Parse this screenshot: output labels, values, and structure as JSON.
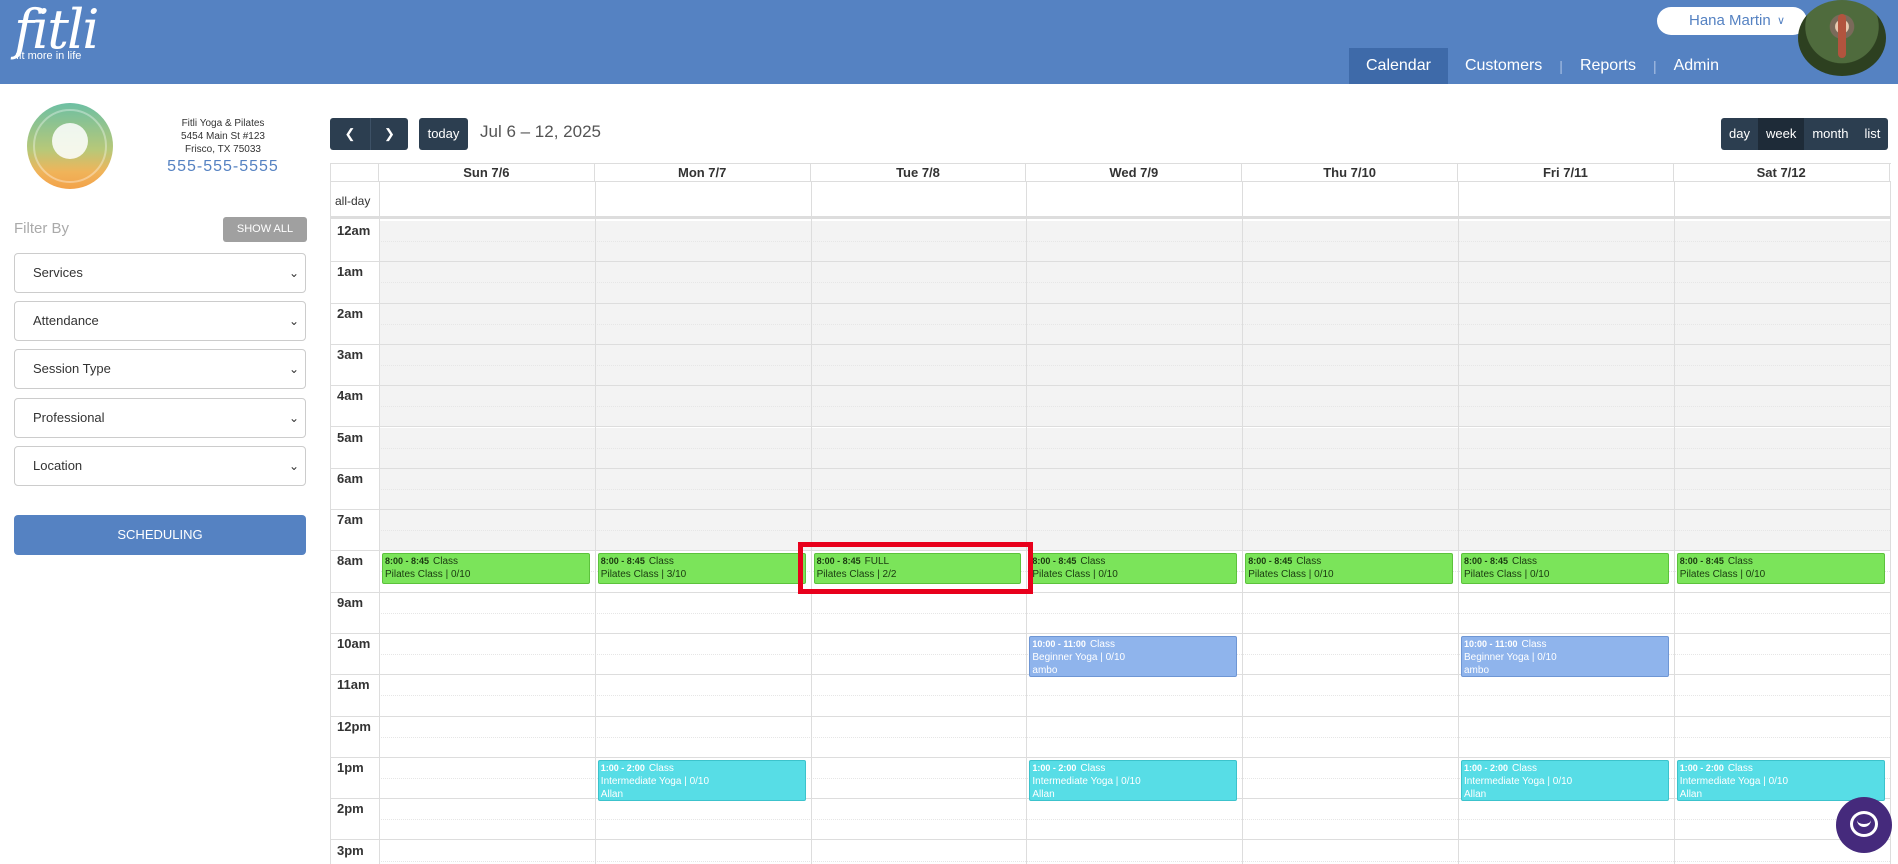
{
  "brand": {
    "word": "fitli",
    "tagline": "fit more in life"
  },
  "user": {
    "name": "Hana Martin",
    "chevron_icon": "double-chevron-down-icon"
  },
  "nav": {
    "items": [
      "Calendar",
      "Customers",
      "Reports",
      "Admin"
    ],
    "active": "Calendar"
  },
  "studio": {
    "name": "Fitli Yoga & Pilates",
    "address1": "5454 Main St #123",
    "address2": "Frisco, TX 75033",
    "phone": "555-555-5555"
  },
  "filters": {
    "label": "Filter By",
    "show_all": "SHOW ALL",
    "selects": [
      "Services",
      "Attendance",
      "Session Type",
      "Professional",
      "Location"
    ],
    "scheduling": "SCHEDULING"
  },
  "toolbar": {
    "prev_icon": "chevron-left-icon",
    "next_icon": "chevron-right-icon",
    "today": "today",
    "range": "Jul 6 – 12, 2025",
    "views": [
      "day",
      "week",
      "month",
      "list"
    ],
    "active_view": "week"
  },
  "calendar": {
    "allday_label": "all-day",
    "days": [
      "Sun 7/6",
      "Mon 7/7",
      "Tue 7/8",
      "Wed 7/9",
      "Thu 7/10",
      "Fri 7/11",
      "Sat 7/12"
    ],
    "hours": [
      "12am",
      "1am",
      "2am",
      "3am",
      "4am",
      "5am",
      "6am",
      "7am",
      "8am",
      "9am",
      "10am",
      "11am",
      "12pm",
      "1pm",
      "2pm",
      "3pm"
    ],
    "events": [
      {
        "day": 0,
        "start": 8,
        "end": 8.75,
        "time": "8:00 - 8:45",
        "tag": "Class",
        "line2": "Pilates Class | 0/10",
        "line3": "",
        "color": "green"
      },
      {
        "day": 1,
        "start": 8,
        "end": 8.75,
        "time": "8:00 - 8:45",
        "tag": "Class",
        "line2": "Pilates Class | 3/10",
        "line3": "",
        "color": "green"
      },
      {
        "day": 2,
        "start": 8,
        "end": 8.75,
        "time": "8:00 - 8:45",
        "tag": "FULL",
        "line2": "Pilates Class | 2/2",
        "line3": "",
        "color": "green"
      },
      {
        "day": 3,
        "start": 8,
        "end": 8.75,
        "time": "8:00 - 8:45",
        "tag": "Class",
        "line2": "Pilates Class | 0/10",
        "line3": "",
        "color": "green"
      },
      {
        "day": 4,
        "start": 8,
        "end": 8.75,
        "time": "8:00 - 8:45",
        "tag": "Class",
        "line2": "Pilates Class | 0/10",
        "line3": "",
        "color": "green"
      },
      {
        "day": 5,
        "start": 8,
        "end": 8.75,
        "time": "8:00 - 8:45",
        "tag": "Class",
        "line2": "Pilates Class | 0/10",
        "line3": "",
        "color": "green"
      },
      {
        "day": 6,
        "start": 8,
        "end": 8.75,
        "time": "8:00 - 8:45",
        "tag": "Class",
        "line2": "Pilates Class | 0/10",
        "line3": "",
        "color": "green"
      },
      {
        "day": 3,
        "start": 10,
        "end": 11,
        "time": "10:00 - 11:00",
        "tag": "Class",
        "line2": "Beginner Yoga | 0/10",
        "line3": "ambo",
        "color": "blue"
      },
      {
        "day": 5,
        "start": 10,
        "end": 11,
        "time": "10:00 - 11:00",
        "tag": "Class",
        "line2": "Beginner Yoga | 0/10",
        "line3": "ambo",
        "color": "blue"
      },
      {
        "day": 1,
        "start": 13,
        "end": 14,
        "time": "1:00 - 2:00",
        "tag": "Class",
        "line2": "Intermediate Yoga | 0/10",
        "line3": "Allan",
        "color": "teal"
      },
      {
        "day": 3,
        "start": 13,
        "end": 14,
        "time": "1:00 - 2:00",
        "tag": "Class",
        "line2": "Intermediate Yoga | 0/10",
        "line3": "Allan",
        "color": "teal"
      },
      {
        "day": 5,
        "start": 13,
        "end": 14,
        "time": "1:00 - 2:00",
        "tag": "Class",
        "line2": "Intermediate Yoga | 0/10",
        "line3": "Allan",
        "color": "teal"
      },
      {
        "day": 6,
        "start": 13,
        "end": 14,
        "time": "1:00 - 2:00",
        "tag": "Class",
        "line2": "Intermediate Yoga | 0/10",
        "line3": "Allan",
        "color": "teal"
      }
    ]
  },
  "chat": {
    "icon": "chat-bubble-icon"
  }
}
